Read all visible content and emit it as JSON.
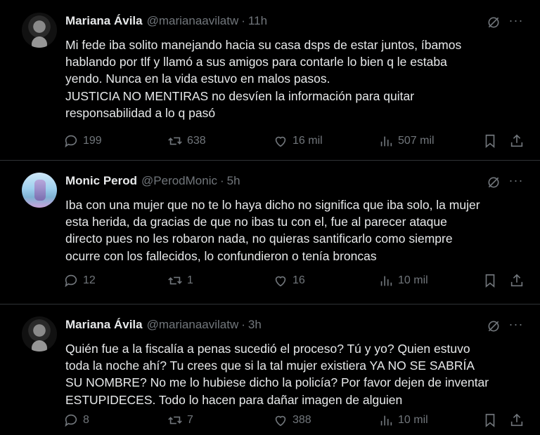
{
  "tweets": [
    {
      "name": "Mariana Ávila",
      "handle": "@marianaavilatw",
      "time": "11h",
      "lines": [
        "Mi fede iba solito manejando hacia su casa dsps de estar juntos, íbamos",
        "hablando por tlf y llamó a sus amigos para contarle lo bien q le estaba",
        "yendo. Nunca en la vida estuvo en malos pasos.",
        "JUSTICIA NO MENTIRAS no desvíen la información para quitar",
        "responsabilidad a lo q pasó"
      ],
      "replies": "199",
      "reposts": "638",
      "likes": "16 mil",
      "views": "507 mil"
    },
    {
      "name": "Monic Perod",
      "handle": "@PerodMonic",
      "time": "5h",
      "lines": [
        "Iba con una mujer que no te lo haya dicho no significa que iba solo, la mujer",
        "esta herida, da gracias de que no ibas tu con el, fue al parecer ataque",
        "directo pues no les robaron nada, no quieras santificarlo como siempre",
        "ocurre con los fallecidos, lo confundieron o tenía broncas"
      ],
      "replies": "12",
      "reposts": "1",
      "likes": "16",
      "views": "10 mil"
    },
    {
      "name": "Mariana Ávila",
      "handle": "@marianaavilatw",
      "time": "3h",
      "lines": [
        "Quién fue a la fiscalía a penas sucedió el proceso? Tú y yo? Quien estuvo",
        "toda la noche ahí? Tu crees que si la tal mujer existiera YA NO SE SABRÍA",
        "SU NOMBRE? No me lo hubiese dicho la policía? Por favor dejen de inventar",
        "ESTUPIDECES. Todo lo hacen para dañar imagen de alguien"
      ],
      "replies": "8",
      "reposts": "7",
      "likes": "388",
      "views": "10 mil"
    }
  ],
  "separator": "·",
  "more_glyph": "···",
  "icons": [
    "grok-icon",
    "more-icon",
    "reply-icon",
    "repost-icon",
    "like-icon",
    "views-icon",
    "bookmark-icon",
    "share-icon"
  ],
  "colors": {
    "background": "#000000",
    "text": "#e7e9ea",
    "muted": "#71767b",
    "divider": "#2f3336"
  }
}
